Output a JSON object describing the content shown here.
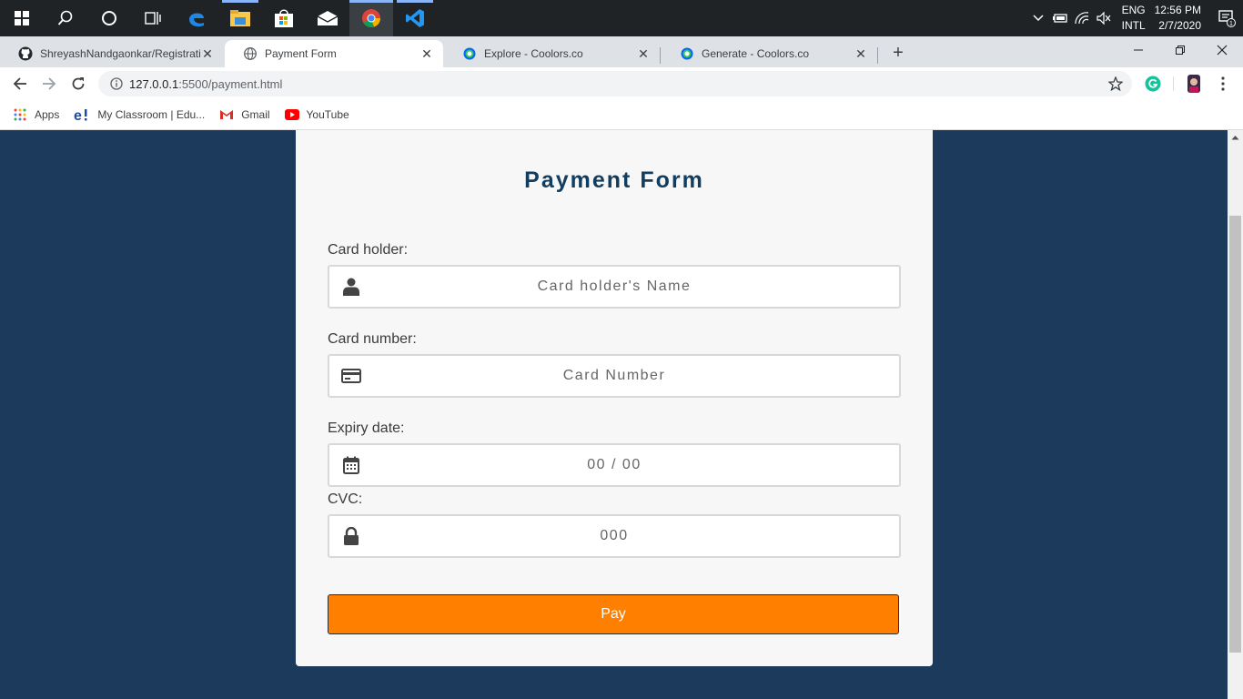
{
  "taskbar": {
    "apps": [
      "start-icon",
      "search-icon",
      "cortana-icon",
      "task-view-icon",
      "edge-icon",
      "file-explorer-icon",
      "store-icon",
      "mail-icon",
      "chrome-icon",
      "vscode-icon"
    ],
    "tray": {
      "lang_top": "ENG",
      "lang_bottom": "INTL",
      "time": "12:56 PM",
      "date": "2/7/2020",
      "notification_count": "1"
    }
  },
  "browser": {
    "tabs": [
      {
        "title": "ShreyashNandgaonkar/Registrati",
        "favicon": "github-icon",
        "active": false
      },
      {
        "title": "Payment Form",
        "favicon": "globe-icon",
        "active": true
      },
      {
        "title": "Explore - Coolors.co",
        "favicon": "coolors-icon",
        "active": false
      },
      {
        "title": "Generate - Coolors.co",
        "favicon": "coolors-icon",
        "active": false
      }
    ],
    "url_host": "127.0.0.1",
    "url_path": ":5500/payment.html",
    "bookmarks": [
      {
        "label": "Apps",
        "icon": "apps-grid-icon"
      },
      {
        "label": "My Classroom | Edu...",
        "icon": "edureka-icon"
      },
      {
        "label": "Gmail",
        "icon": "gmail-icon"
      },
      {
        "label": "YouTube",
        "icon": "youtube-icon"
      }
    ]
  },
  "form": {
    "title": "Payment Form",
    "card_holder": {
      "label": "Card holder:",
      "placeholder": "Card holder's Name",
      "icon": "user-icon"
    },
    "card_number": {
      "label": "Card number:",
      "placeholder": "Card Number",
      "icon": "credit-card-icon"
    },
    "expiry": {
      "label": "Expiry date:",
      "placeholder": "00 / 00",
      "icon": "calendar-icon"
    },
    "cvc": {
      "label": "CVC:",
      "placeholder": "000",
      "icon": "lock-icon"
    },
    "pay_label": "Pay"
  },
  "colors": {
    "page_bg": "#1b3a5c",
    "card_bg": "#f7f7f7",
    "title": "#123d5e",
    "pay_button": "#ff7f00"
  }
}
